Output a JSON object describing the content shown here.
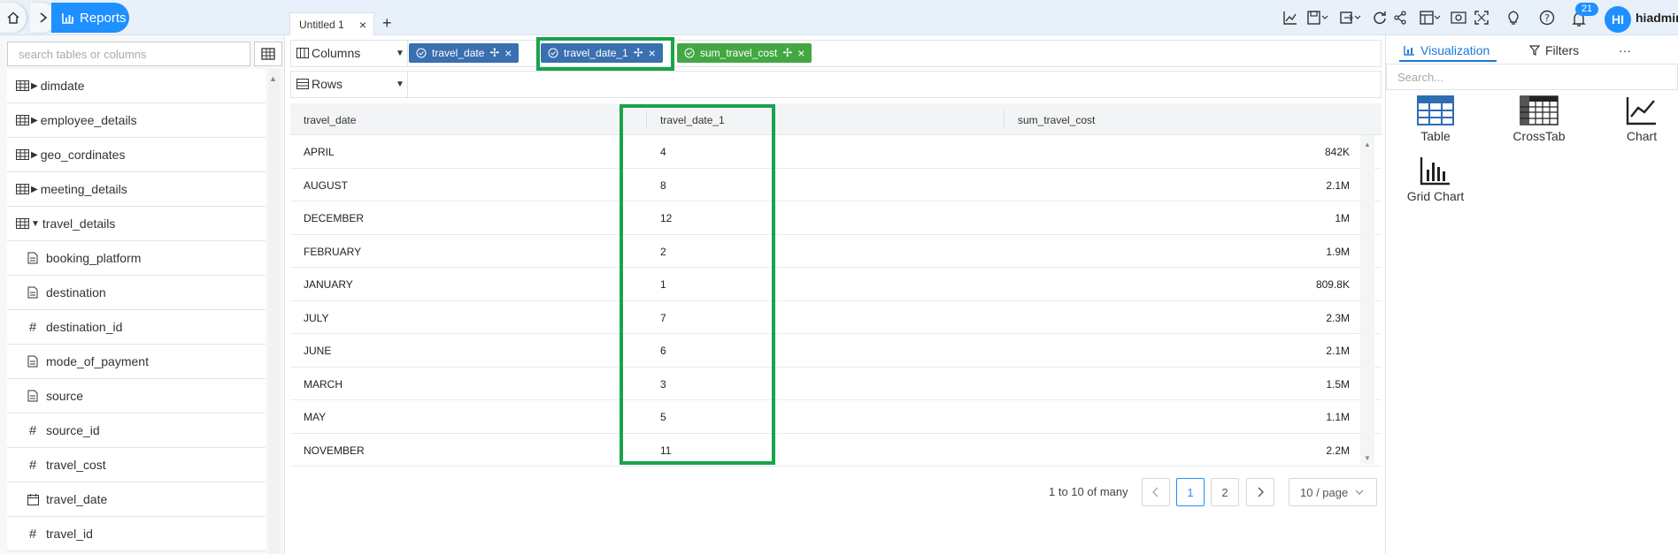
{
  "topbar": {
    "reports_label": "Reports",
    "doc_tab": "Untitled 1",
    "notification_count": "21",
    "avatar_initials": "HI",
    "username": "hiadmin"
  },
  "sidebar": {
    "search_placeholder": "search tables or columns",
    "tables": [
      {
        "label": "dimdate"
      },
      {
        "label": "employee_details"
      },
      {
        "label": "geo_cordinates"
      },
      {
        "label": "meeting_details"
      },
      {
        "label": "travel_details"
      }
    ],
    "columns": [
      {
        "label": "booking_platform",
        "type": "text"
      },
      {
        "label": "destination",
        "type": "text"
      },
      {
        "label": "destination_id",
        "type": "number"
      },
      {
        "label": "mode_of_payment",
        "type": "text"
      },
      {
        "label": "source",
        "type": "text"
      },
      {
        "label": "source_id",
        "type": "number"
      },
      {
        "label": "travel_cost",
        "type": "number"
      },
      {
        "label": "travel_date",
        "type": "date"
      },
      {
        "label": "travel_id",
        "type": "number"
      }
    ]
  },
  "fields": {
    "columns_label": "Columns",
    "rows_label": "Rows",
    "column_chips": [
      {
        "label": "travel_date",
        "color": "#3a6fb0"
      },
      {
        "label": "travel_date_1",
        "color": "#3a6fb0"
      },
      {
        "label": "sum_travel_cost",
        "color": "#43a843"
      }
    ]
  },
  "table": {
    "headers": [
      "travel_date",
      "travel_date_1",
      "sum_travel_cost"
    ],
    "rows": [
      [
        "APRIL",
        "4",
        "842K"
      ],
      [
        "AUGUST",
        "8",
        "2.1M"
      ],
      [
        "DECEMBER",
        "12",
        "1M"
      ],
      [
        "FEBRUARY",
        "2",
        "1.9M"
      ],
      [
        "JANUARY",
        "1",
        "809.8K"
      ],
      [
        "JULY",
        "7",
        "2.3M"
      ],
      [
        "JUNE",
        "6",
        "2.1M"
      ],
      [
        "MARCH",
        "3",
        "1.5M"
      ],
      [
        "MAY",
        "5",
        "1.1M"
      ],
      [
        "NOVEMBER",
        "11",
        "2.2M"
      ]
    ]
  },
  "pagination": {
    "summary": "1 to 10 of many",
    "pages": [
      "1",
      "2"
    ],
    "current_page": "1",
    "page_size": "10 / page"
  },
  "right_panel": {
    "tabs": [
      "Visualization",
      "Filters"
    ],
    "more": "···",
    "search_placeholder": "Search...",
    "visualizations": [
      "Table",
      "CrossTab",
      "Chart",
      "Grid Chart"
    ]
  },
  "colors": {
    "accent": "#1e90ff",
    "highlight_box": "#1aa34a"
  }
}
